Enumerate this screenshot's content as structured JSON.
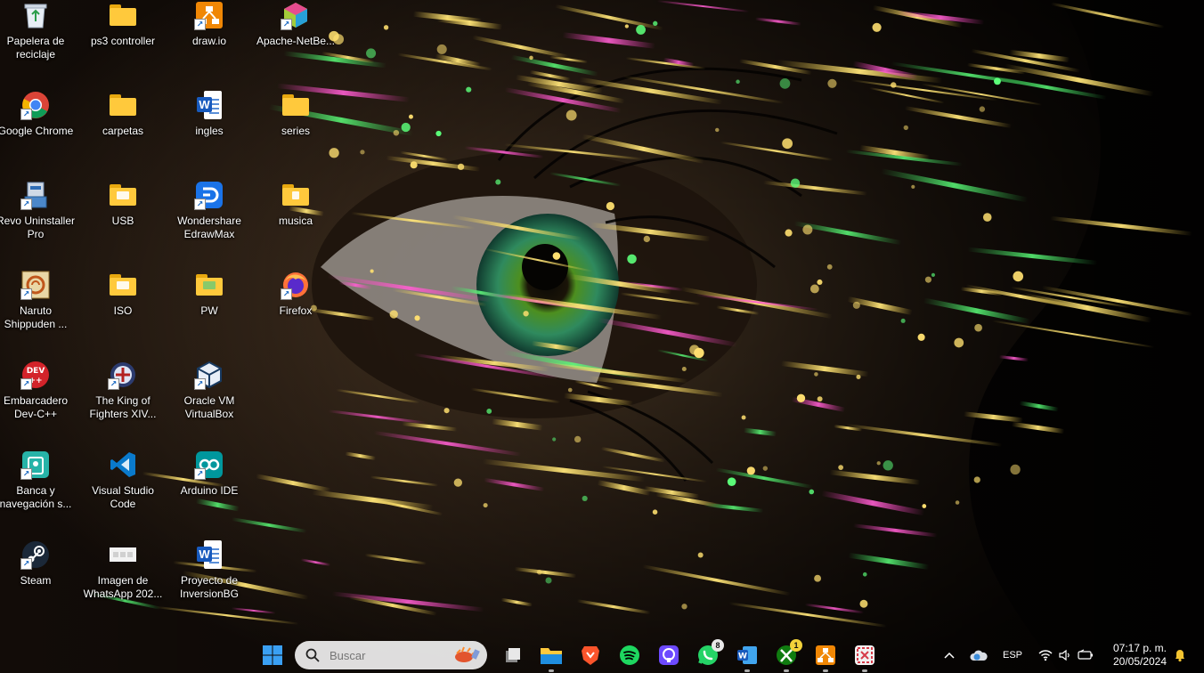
{
  "desktop": {
    "icons": [
      {
        "label": "Papelera de reciclaje",
        "icon": "recycle-bin-icon"
      },
      {
        "label": "ps3 controller",
        "icon": "folder-icon"
      },
      {
        "label": "draw.io",
        "icon": "drawio-icon"
      },
      {
        "label": "Apache-NetBe...",
        "icon": "netbeans-icon"
      },
      {
        "label": "Google Chrome",
        "icon": "chrome-icon"
      },
      {
        "label": "carpetas",
        "icon": "folder-icon"
      },
      {
        "label": "ingles",
        "icon": "word-doc-icon"
      },
      {
        "label": "series",
        "icon": "folder-icon"
      },
      {
        "label": "Revo Uninstaller Pro",
        "icon": "revo-uninstaller-icon"
      },
      {
        "label": "USB",
        "icon": "folder-icon"
      },
      {
        "label": "Wondershare EdrawMax",
        "icon": "edrawmax-icon"
      },
      {
        "label": "musica",
        "icon": "folder-icon"
      },
      {
        "label": "Naruto Shippuden ...",
        "icon": "naruto-game-icon"
      },
      {
        "label": "ISO",
        "icon": "folder-icon"
      },
      {
        "label": "PW",
        "icon": "folder-icon"
      },
      {
        "label": "Firefox",
        "icon": "firefox-icon"
      },
      {
        "label": "Embarcadero Dev-C++",
        "icon": "devcpp-icon"
      },
      {
        "label": "The King of Fighters XIV...",
        "icon": "kof-game-icon"
      },
      {
        "label": "Oracle VM VirtualBox",
        "icon": "virtualbox-icon"
      },
      {
        "label": "Banca y navegación s...",
        "icon": "safe-banking-icon"
      },
      {
        "label": "Visual Studio Code",
        "icon": "vscode-icon"
      },
      {
        "label": "Arduino IDE",
        "icon": "arduino-icon"
      },
      {
        "label": "Steam",
        "icon": "steam-icon"
      },
      {
        "label": "Imagen de WhatsApp 202...",
        "icon": "image-file-icon"
      },
      {
        "label": "Proyecto de InversionBG",
        "icon": "word-doc-icon"
      }
    ]
  },
  "taskbar": {
    "search": {
      "placeholder": "Buscar"
    },
    "pinned": [
      {
        "name": "start-button"
      },
      {
        "name": "task-view-button"
      },
      {
        "name": "file-explorer-button"
      },
      {
        "name": "brave-button"
      },
      {
        "name": "spotify-button"
      },
      {
        "name": "proton-button"
      },
      {
        "name": "whatsapp-button",
        "badge": "8"
      },
      {
        "name": "word-button"
      },
      {
        "name": "xbox-button",
        "badge": "1"
      },
      {
        "name": "drawio-button"
      },
      {
        "name": "snipping-tool-button"
      }
    ],
    "tray": {
      "language": "ESP",
      "time": "07:17 p. m.",
      "date": "20/05/2024"
    }
  },
  "colors": {
    "taskbar_bg": "#140f0c",
    "folder": "#ffc93c",
    "accent_blue": "#0078d4"
  }
}
